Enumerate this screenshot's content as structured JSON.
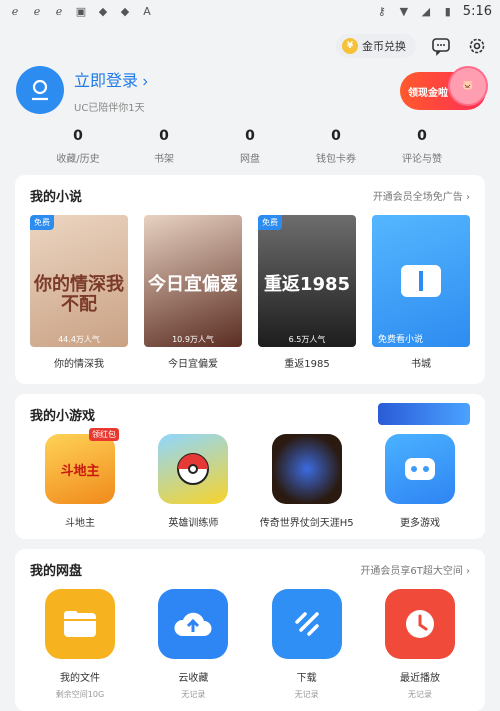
{
  "status_bar": {
    "time": "5:16",
    "left_icons": [
      "browser-e-icon",
      "browser-e-icon",
      "browser-e-icon",
      "image-icon",
      "android-icon",
      "android-icon",
      "a-badge-icon"
    ],
    "right_icons": [
      "key-icon",
      "wifi-icon",
      "signal-icon",
      "battery-icon"
    ]
  },
  "topbar": {
    "coin_label": "金币兑换"
  },
  "profile": {
    "login_title": "立即登录 ›",
    "login_sub": "UC已陪伴你1天",
    "promo_label": "领现金啦"
  },
  "stats": [
    {
      "num": "0",
      "label": "收藏/历史"
    },
    {
      "num": "0",
      "label": "书架"
    },
    {
      "num": "0",
      "label": "网盘"
    },
    {
      "num": "0",
      "label": "钱包卡券"
    },
    {
      "num": "0",
      "label": "评论与赞"
    }
  ],
  "novels": {
    "title": "我的小说",
    "link": "开通会员全场免广告 ›",
    "items": [
      {
        "name": "你的情深我",
        "tag": "免费",
        "readers": "44.4万人气",
        "cover_text": "你的情深我不配",
        "color": "#d9b89a"
      },
      {
        "name": "今日宜偏爱",
        "tag": "",
        "readers": "10.9万人气",
        "cover_text": "今日宜偏爱",
        "color": "#6b3a2e"
      },
      {
        "name": "重返1985",
        "tag": "免费",
        "readers": "6.5万人气",
        "cover_text": "重返1985",
        "color": "#3a3a3a"
      },
      {
        "name": "书城",
        "tag": "",
        "readers": "免费看小说",
        "cover_text": "",
        "color": "#3aa0ff"
      }
    ]
  },
  "games": {
    "title": "我的小游戏",
    "items": [
      {
        "name": "斗地主",
        "tag": "领红包",
        "color": "#f4b23a",
        "text": "斗地主"
      },
      {
        "name": "英雄训练师",
        "tag": "",
        "color": "#4bb9f0",
        "text": ""
      },
      {
        "name": "传奇世界仗剑天涯H5",
        "tag": "",
        "color": "#3b2a1e",
        "text": ""
      },
      {
        "name": "更多游戏",
        "tag": "",
        "color": "#3c9cf8",
        "text": ""
      }
    ]
  },
  "disk": {
    "title": "我的网盘",
    "link": "开通会员享6T超大空间 ›",
    "items": [
      {
        "name": "我的文件",
        "sub": "剩余空间10G",
        "color": "#f7b21f",
        "icon": "folder-icon"
      },
      {
        "name": "云收藏",
        "sub": "无记录",
        "color": "#2d86f3",
        "icon": "cloud-upload-icon"
      },
      {
        "name": "下载",
        "sub": "无记录",
        "color": "#2f8ff5",
        "icon": "download-icon"
      },
      {
        "name": "最近播放",
        "sub": "无记录",
        "color": "#f04a3a",
        "icon": "clock-icon"
      }
    ]
  }
}
